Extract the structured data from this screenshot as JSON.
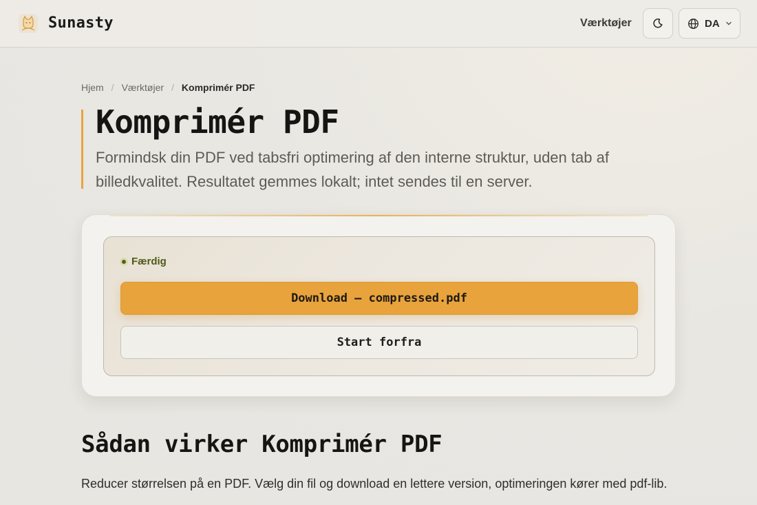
{
  "header": {
    "brand": "Sunasty",
    "nav_tools": "Værktøjer",
    "language": "DA",
    "icons": {
      "logo": "cat-logo-icon",
      "theme": "moon-icon",
      "language": "globe-icon",
      "dropdown": "chevron-down-icon"
    }
  },
  "breadcrumb": {
    "home": "Hjem",
    "sep1": "/",
    "tools": "Værktøjer",
    "sep2": "/",
    "current": "Komprimér PDF"
  },
  "hero": {
    "title": "Komprimér PDF",
    "subtitle": "Formindsk din PDF ved tabsfri optimering af den interne struktur, uden tab af billedkvalitet. Resultatet gemmes lokalt; intet sendes til en server."
  },
  "result": {
    "status": "Færdig",
    "download_label": "Download — compressed.pdf",
    "restart_label": "Start forfra"
  },
  "how": {
    "title": "Sådan virker Komprimér PDF",
    "text": "Reducer størrelsen på en PDF. Vælg din fil og download en lettere version, optimeringen kører med pdf-lib."
  },
  "colors": {
    "accent": "#e8a33d",
    "status": "#556216",
    "background": "#e9e7e2"
  }
}
